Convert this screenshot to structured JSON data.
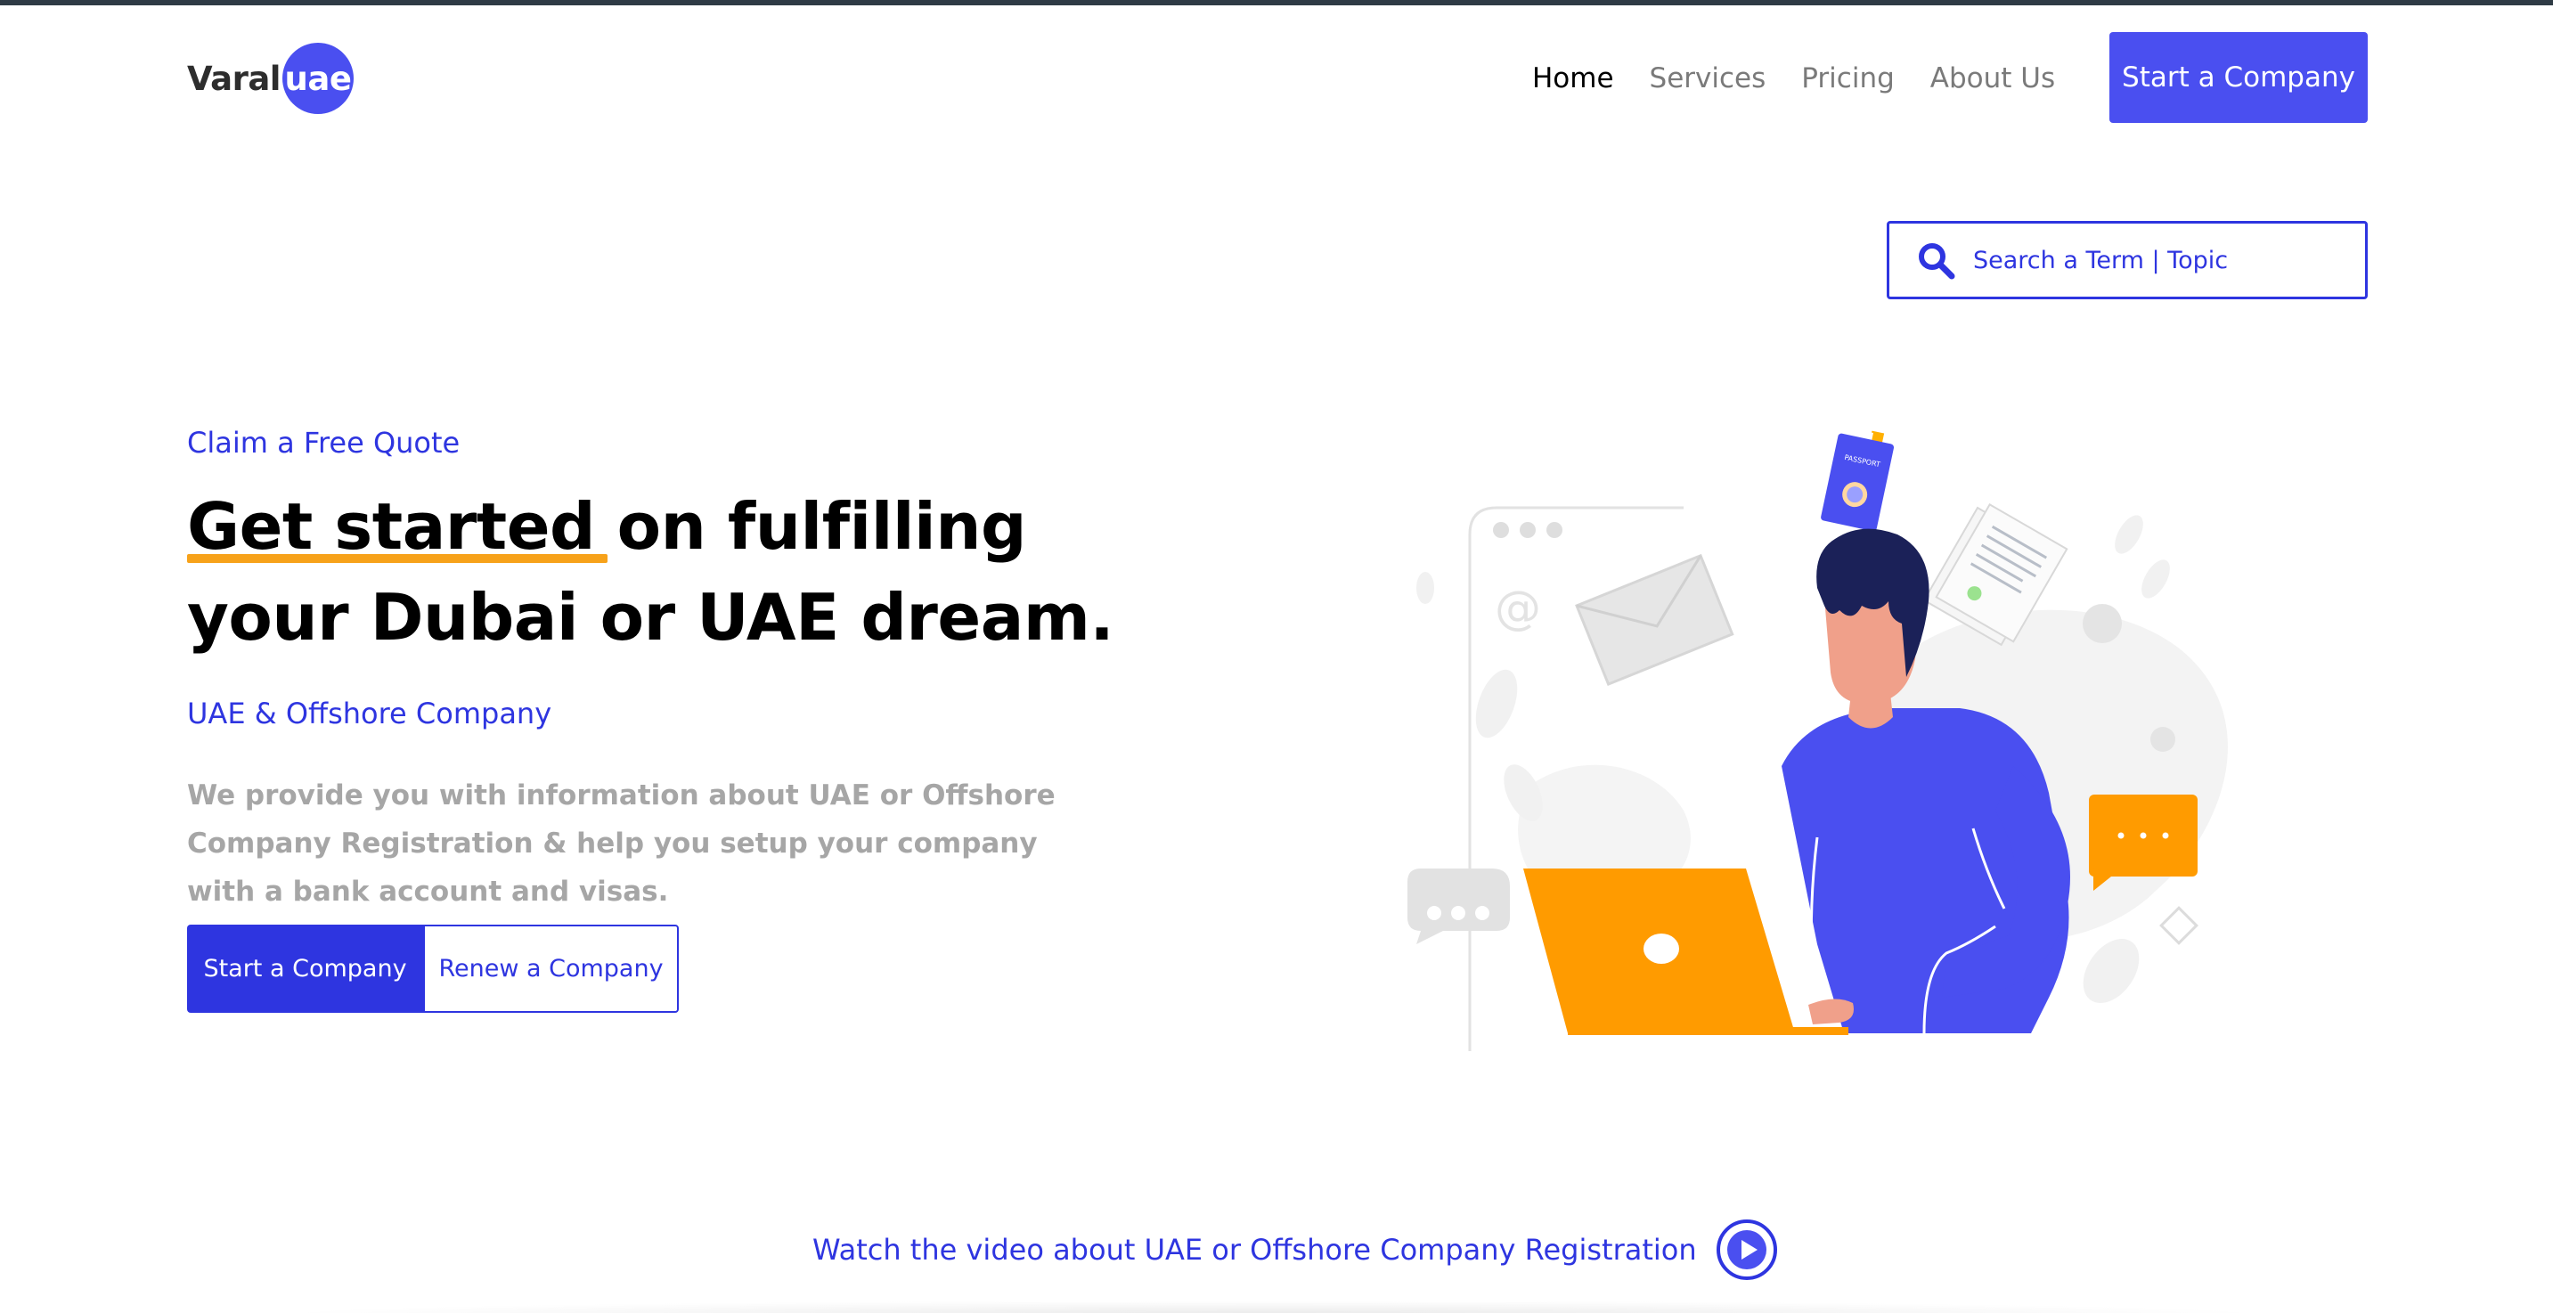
{
  "brand": {
    "name_part1": "Varal",
    "name_part2": "uae"
  },
  "nav": {
    "items": [
      {
        "label": "Home",
        "active": true
      },
      {
        "label": "Services",
        "active": false
      },
      {
        "label": "Pricing",
        "active": false
      },
      {
        "label": "About Us",
        "active": false
      }
    ],
    "cta_label": "Start a Company"
  },
  "search": {
    "placeholder": "Search a Term | Topic",
    "icon": "search-icon"
  },
  "hero": {
    "eyebrow": "Claim a Free Quote",
    "headline_highlight": "Get started",
    "headline_rest_line1": " on fulfilling",
    "headline_line2": "your Dubai or UAE dream.",
    "subheading": "UAE & Offshore Company",
    "description": "We provide you with information about UAE or Offshore Company Registration & help you setup your company with a bank account and visas.",
    "primary_button": "Start a Company",
    "secondary_button": "Renew a Company",
    "passport_label": "PASSPORT"
  },
  "video": {
    "label": "Watch the video about UAE or Offshore Company Registration",
    "icon": "play-icon"
  },
  "colors": {
    "accent": "#4a4ff0",
    "link": "#2e35e0",
    "highlight": "#f7a21a",
    "muted_text": "#a6a6a6"
  }
}
